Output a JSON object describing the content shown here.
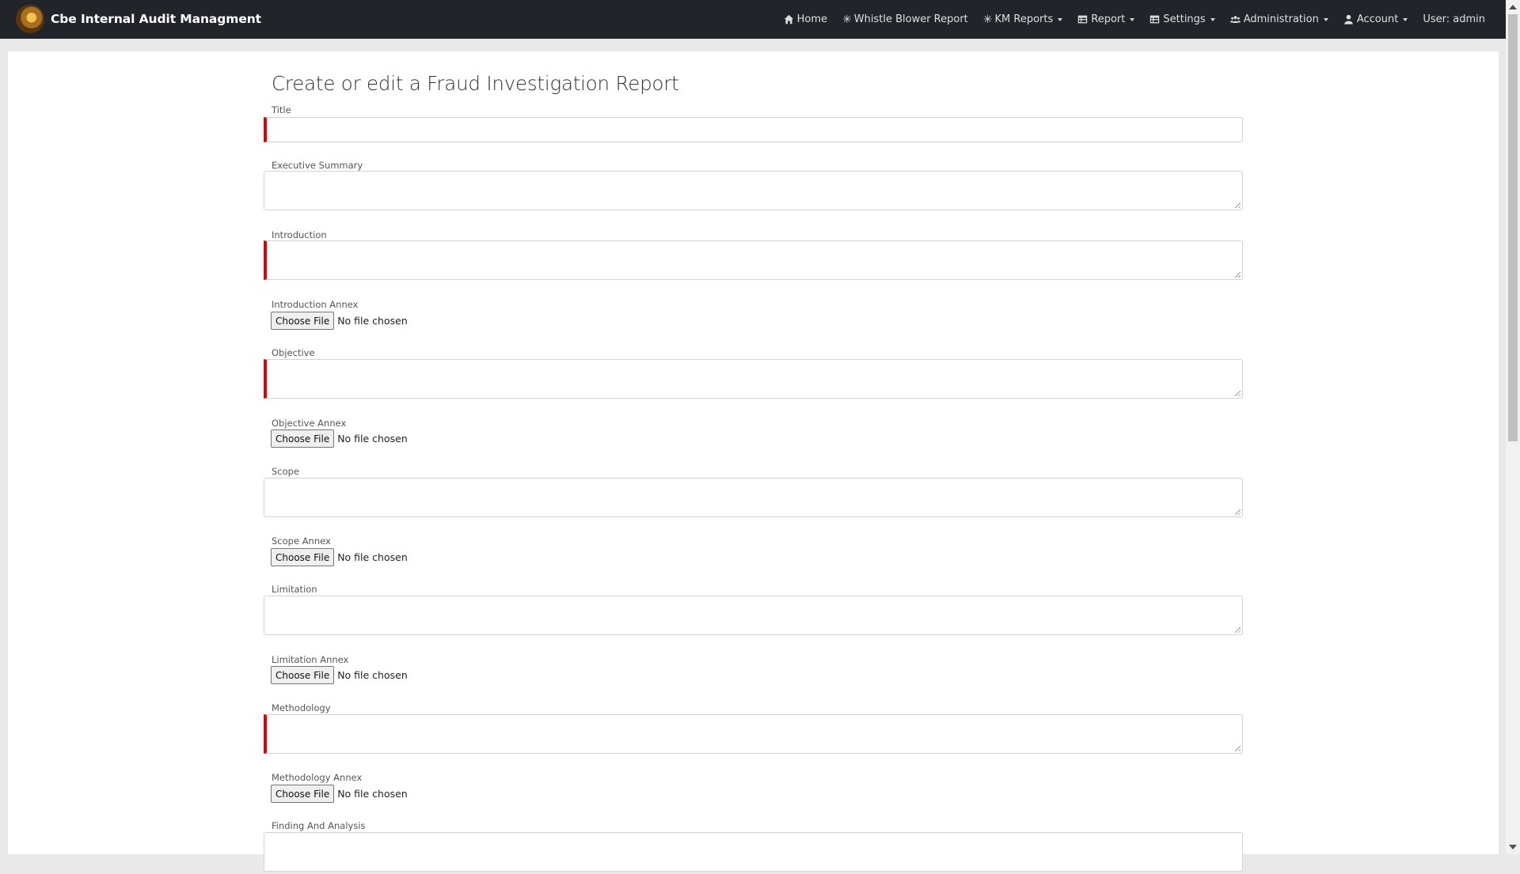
{
  "app": {
    "title": "Cbe Internal Audit Managment"
  },
  "nav": {
    "home": "Home",
    "whistle": "Whistle Blower Report",
    "km_reports": "KM Reports",
    "report": "Report",
    "settings": "Settings",
    "administration": "Administration",
    "account": "Account",
    "user": "User: admin"
  },
  "page": {
    "heading": "Create or edit a Fraud Investigation Report"
  },
  "form": {
    "title_label": "Title",
    "exec_summary_label": "Executive Summary",
    "introduction_label": "Introduction",
    "introduction_annex_label": "Introduction Annex",
    "objective_label": "Objective",
    "objective_annex_label": "Objective Annex",
    "scope_label": "Scope",
    "scope_annex_label": "Scope Annex",
    "limitation_label": "Limitation",
    "limitation_annex_label": "Limitation Annex",
    "methodology_label": "Methodology",
    "methodology_annex_label": "Methodology Annex",
    "finding_label": "Finding And Analysis",
    "choose_file": "Choose File",
    "no_file": "No file chosen"
  },
  "colors": {
    "navbar": "#212529",
    "required_marker": "#e00000",
    "background": "#e9e9e9"
  },
  "icons": [
    "house-icon",
    "asterisk-icon",
    "table-icon",
    "users-icon",
    "user-icon",
    "logo-icon"
  ]
}
